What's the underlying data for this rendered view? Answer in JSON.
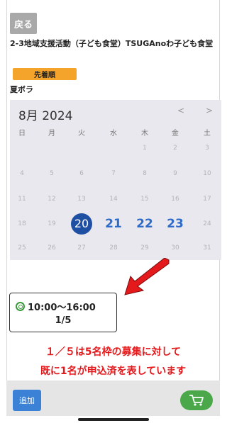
{
  "header": {
    "back_label": "戻る"
  },
  "event": {
    "title": "2-3地域支援活動（子ども食堂）TSUGAnoわ子ども食堂",
    "badge": "先着順",
    "subtitle": "夏ボラ"
  },
  "calendar": {
    "month_label": "8月 2024",
    "prev_icon": "chevron-left-icon",
    "next_icon": "chevron-right-icon",
    "weekdays": [
      "日",
      "月",
      "火",
      "水",
      "木",
      "金",
      "土"
    ],
    "weeks": [
      [
        "",
        "",
        "",
        "",
        "1",
        "2",
        "3"
      ],
      [
        "4",
        "5",
        "6",
        "7",
        "8",
        "9",
        "10"
      ],
      [
        "11",
        "12",
        "13",
        "14",
        "15",
        "16",
        "17"
      ],
      [
        "18",
        "19",
        "20",
        "21",
        "22",
        "23",
        "24"
      ],
      [
        "25",
        "26",
        "27",
        "28",
        "29",
        "30",
        "31"
      ]
    ],
    "available_days": [
      "20",
      "21",
      "22",
      "23"
    ],
    "selected_day": "20",
    "colors": {
      "selected_bg": "#1f4fa3",
      "available": "#2e6bc9",
      "disabled": "#b2b2b8"
    }
  },
  "slot": {
    "status_icon": "double-circle-icon",
    "time": "10:00〜16:00",
    "capacity": "1/5"
  },
  "annotation": {
    "line1": "１／５は5名枠の募集に対して",
    "line2": "既に1名が申込済を表しています",
    "color": "#e3191c"
  },
  "footer": {
    "add_label": "追加",
    "cart_icon": "cart-icon"
  }
}
